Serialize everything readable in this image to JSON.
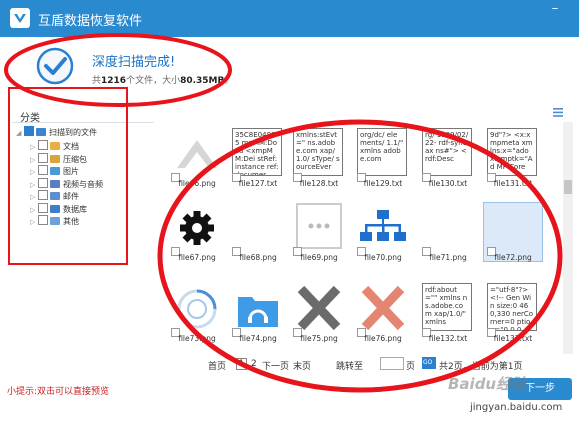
{
  "app": {
    "title": "互盾数据恢复软件",
    "minimize_glyph": "–"
  },
  "status": {
    "title": "深度扫描完成!",
    "summary_prefix": "共",
    "file_count": "1216",
    "summary_middle": "个文件，大小",
    "total_size": "80.35MB",
    "summary_suffix": "。"
  },
  "sidebar": {
    "title": "分类",
    "root": "扫描到的文件",
    "items": [
      {
        "label": "文档",
        "icon": "document-icon",
        "color": "#e8b040"
      },
      {
        "label": "压缩包",
        "icon": "archive-icon",
        "color": "#d9a43b"
      },
      {
        "label": "图片",
        "icon": "image-icon",
        "color": "#4a9ad8"
      },
      {
        "label": "视频与音频",
        "icon": "media-icon",
        "color": "#5a7fbf"
      },
      {
        "label": "邮件",
        "icon": "mail-icon",
        "color": "#5b8fd0"
      },
      {
        "label": "数据库",
        "icon": "database-icon",
        "color": "#3f7dc4"
      },
      {
        "label": "其他",
        "icon": "other-icon",
        "color": "#6fa0d8"
      }
    ]
  },
  "grid": {
    "rows": [
      [
        {
          "name": "file66.png",
          "kind": "image",
          "icon": "arrow-up-image"
        },
        {
          "name": "file127.txt",
          "kind": "text",
          "preview": "35C8E04885 mpMM:Docu <xmpMM:Dei stRef:instance ref:documer"
        },
        {
          "name": "file128.txt",
          "kind": "text",
          "preview": "xmlns:stEvt=\" ns.adobe.com xap/1.0/ sType/ sourceEver"
        },
        {
          "name": "file129.txt",
          "kind": "text",
          "preview": "org/dc/ elements/ 1.1/\" xmlns adobe.com"
        },
        {
          "name": "file130.txt",
          "kind": "text",
          "preview": "rg/ 1999/02/22- rdf-syntax ns#\"> <rdf:Desc"
        },
        {
          "name": "file131.txt",
          "kind": "text",
          "preview": "9d\"?> <x:xmpmeta xmlns:x=\"ado x:xmptk=\"Ad MP Core"
        }
      ],
      [
        {
          "name": "file67.png",
          "kind": "image",
          "icon": "gear-image"
        },
        {
          "name": "file68.png",
          "kind": "image",
          "icon": "blank-image"
        },
        {
          "name": "file69.png",
          "kind": "image",
          "icon": "ellipsis-image"
        },
        {
          "name": "file70.png",
          "kind": "image",
          "icon": "sitemap-image"
        },
        {
          "name": "file71.png",
          "kind": "image",
          "icon": "blank-image"
        },
        {
          "name": "file72.png",
          "kind": "image",
          "icon": "blank-image",
          "selected": true
        }
      ],
      [
        {
          "name": "file73.png",
          "kind": "image",
          "icon": "spinner-image"
        },
        {
          "name": "file74.png",
          "kind": "image",
          "icon": "folder-headphone-image"
        },
        {
          "name": "file75.png",
          "kind": "image",
          "icon": "gray-x-image"
        },
        {
          "name": "file76.png",
          "kind": "image",
          "icon": "red-x-image"
        },
        {
          "name": "file132.txt",
          "kind": "text",
          "preview": "rdf:about=\"\" xmlns ns.adobe.com xap/1.0/\" xmlns"
        },
        {
          "name": "file133.txt",
          "kind": "text",
          "preview": "=\"utf-8\"?> <!-- Gen Win size:0 460,330 nerCorner=0 ption=\"0,0,0"
        }
      ]
    ]
  },
  "pagination": {
    "home": "首页",
    "page1": "1",
    "page2": "2",
    "next": "下一页",
    "last": "末页",
    "jump_to": "跳转至",
    "page_unit": "页",
    "go_glyph": "GO",
    "total_text": "共2页，当前为第1页"
  },
  "footer": {
    "tip": "小提示:双击可以直接预览",
    "next_step": "下一步"
  },
  "watermark": {
    "brand": "Baidu经验",
    "url": "jingyan.baidu.com"
  },
  "colors": {
    "accent": "#2a8ad0",
    "annotation": "#e8141c"
  }
}
